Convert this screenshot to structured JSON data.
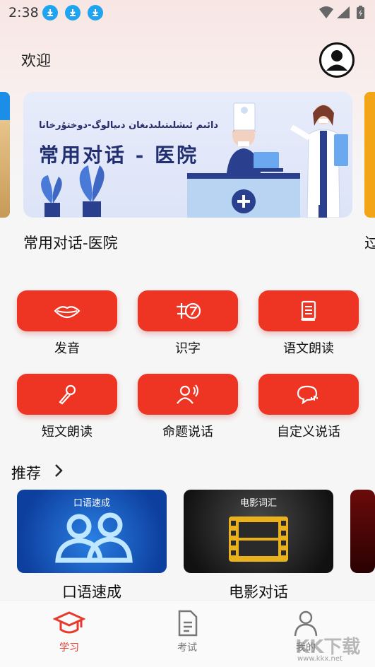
{
  "status_bar": {
    "time": "2:38"
  },
  "header": {
    "welcome": "欢迎"
  },
  "carousel": {
    "current": {
      "subtitle": "دائىم ئىشلىتىلىدىغان دىيالوگ-دوختۇرخانا",
      "title": "常用对话 - 医院",
      "caption": "常用对话-医院"
    },
    "next_caption": "过"
  },
  "features": [
    {
      "label": "发音",
      "icon": "lips-icon"
    },
    {
      "label": "识字",
      "icon": "character-icon"
    },
    {
      "label": "语文朗读",
      "icon": "book-icon"
    },
    {
      "label": "短文朗读",
      "icon": "microphone-icon"
    },
    {
      "label": "命题说话",
      "icon": "speaker-icon"
    },
    {
      "label": "自定义说话",
      "icon": "chat-bubble-icon"
    }
  ],
  "recommend": {
    "title": "推荐",
    "cards": [
      {
        "top_label": "口语速成",
        "caption": "口语速成"
      },
      {
        "top_label": "电影词汇",
        "caption": "电影对话"
      }
    ]
  },
  "bottom_nav": [
    {
      "label": "学习",
      "icon": "graduation-cap-icon",
      "active": true
    },
    {
      "label": "考试",
      "icon": "document-icon",
      "active": false
    },
    {
      "label": "我的",
      "icon": "user-icon",
      "active": false
    }
  ],
  "watermark": {
    "text": "KK下载",
    "url": "www.kkx.net"
  },
  "colors": {
    "accent": "#ee3524",
    "banner_text": "#223072"
  }
}
